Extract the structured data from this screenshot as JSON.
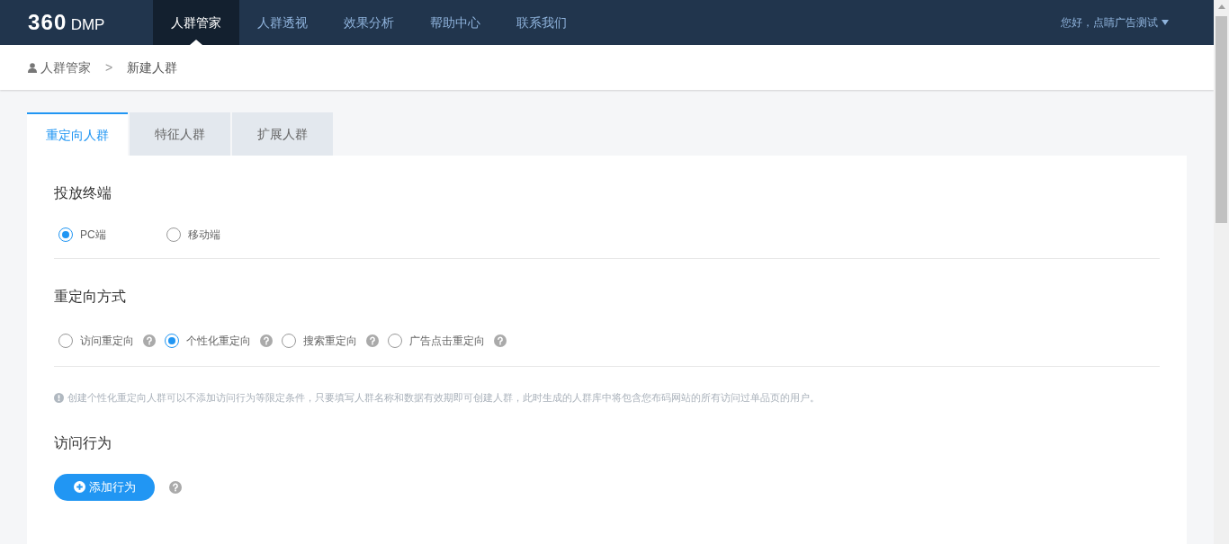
{
  "nav": {
    "logo": "360",
    "logo_suffix": "DMP",
    "items": [
      {
        "label": "人群管家",
        "selected": true
      },
      {
        "label": "人群透视",
        "selected": false
      },
      {
        "label": "效果分析",
        "selected": false
      },
      {
        "label": "帮助中心",
        "selected": false
      },
      {
        "label": "联系我们",
        "selected": false
      }
    ],
    "user": "您好，点睛广告测试"
  },
  "breadcrumb": {
    "parent": "人群管家",
    "separator": ">",
    "current": "新建人群"
  },
  "tabs": [
    {
      "label": "重定向人群",
      "selected": true
    },
    {
      "label": "特征人群",
      "selected": false
    },
    {
      "label": "扩展人群",
      "selected": false
    }
  ],
  "terminal": {
    "title": "投放终端",
    "options": [
      {
        "label": "PC端",
        "selected": true
      },
      {
        "label": "移动端",
        "selected": false
      }
    ]
  },
  "method": {
    "title": "重定向方式",
    "options": [
      {
        "label": "访问重定向",
        "selected": false
      },
      {
        "label": "个性化重定向",
        "selected": true
      },
      {
        "label": "搜索重定向",
        "selected": false
      },
      {
        "label": "广告点击重定向",
        "selected": false
      }
    ]
  },
  "notice": "创建个性化重定向人群可以不添加访问行为等限定条件，只要填写人群名称和数据有效期即可创建人群，此时生成的人群库中将包含您布码网站的所有访问过单品页的用户。",
  "behavior": {
    "title": "访问行为",
    "button": "添加行为"
  }
}
